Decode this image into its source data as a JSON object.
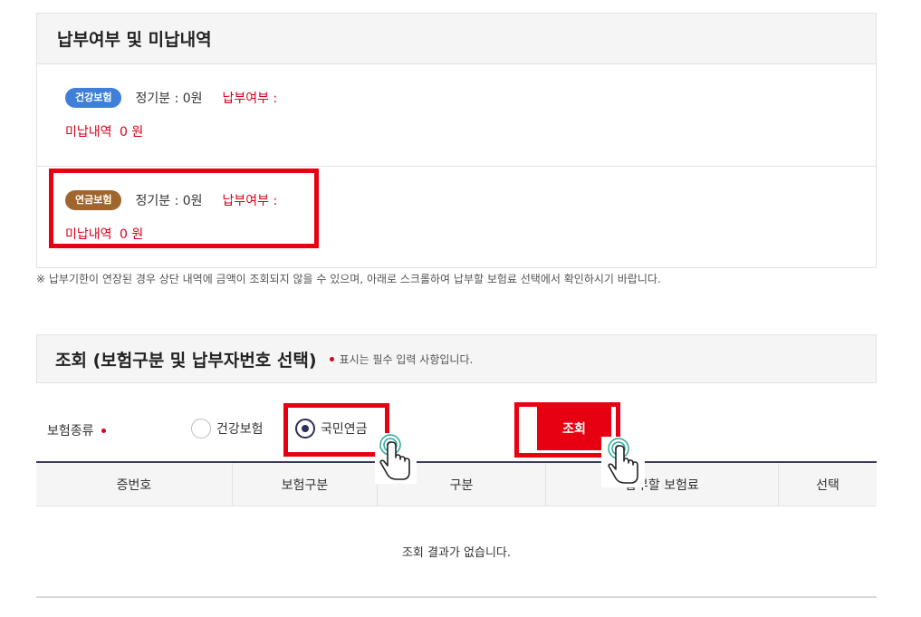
{
  "payment": {
    "title": "납부여부 및 미납내역",
    "items": [
      {
        "badge": "건강보험",
        "badge_color": "#3f7fd9",
        "regular": "정기분 : 0원",
        "paid_label": "납부여부 :",
        "unpaid_label": "미납내역",
        "unpaid_amount": "0 원"
      },
      {
        "badge": "연금보험",
        "badge_color": "#a0662e",
        "regular": "정기분 : 0원",
        "paid_label": "납부여부 :",
        "unpaid_label": "미납내역",
        "unpaid_amount": "0 원"
      }
    ],
    "note": "※ 납부기한이 연장된 경우 상단 내역에 금액이 조회되지 않을 수 있으며, 아래로 스크롤하여 납부할 보험료 선택에서 확인하시기 바랍니다."
  },
  "search": {
    "title": "조회 (보험구분 및 납부자번호 선택)",
    "required_note": "표시는 필수 입력 사항입니다.",
    "type_label": "보험종류",
    "options": [
      {
        "label": "건강보험",
        "selected": false
      },
      {
        "label": "국민연금",
        "selected": true
      }
    ],
    "search_button": "조회"
  },
  "table": {
    "headers": [
      "증번호",
      "보험구분",
      "구분",
      "납부할 보험료",
      "선택"
    ],
    "empty_message": "조회 결과가 없습니다."
  },
  "colors": {
    "accent_red": "#e60012",
    "text_red": "#d9001b",
    "header_line": "#3a3a5c",
    "cursor_teal": "#2aa89a"
  },
  "icons": {
    "cursor": "hand-pointer-icon"
  }
}
